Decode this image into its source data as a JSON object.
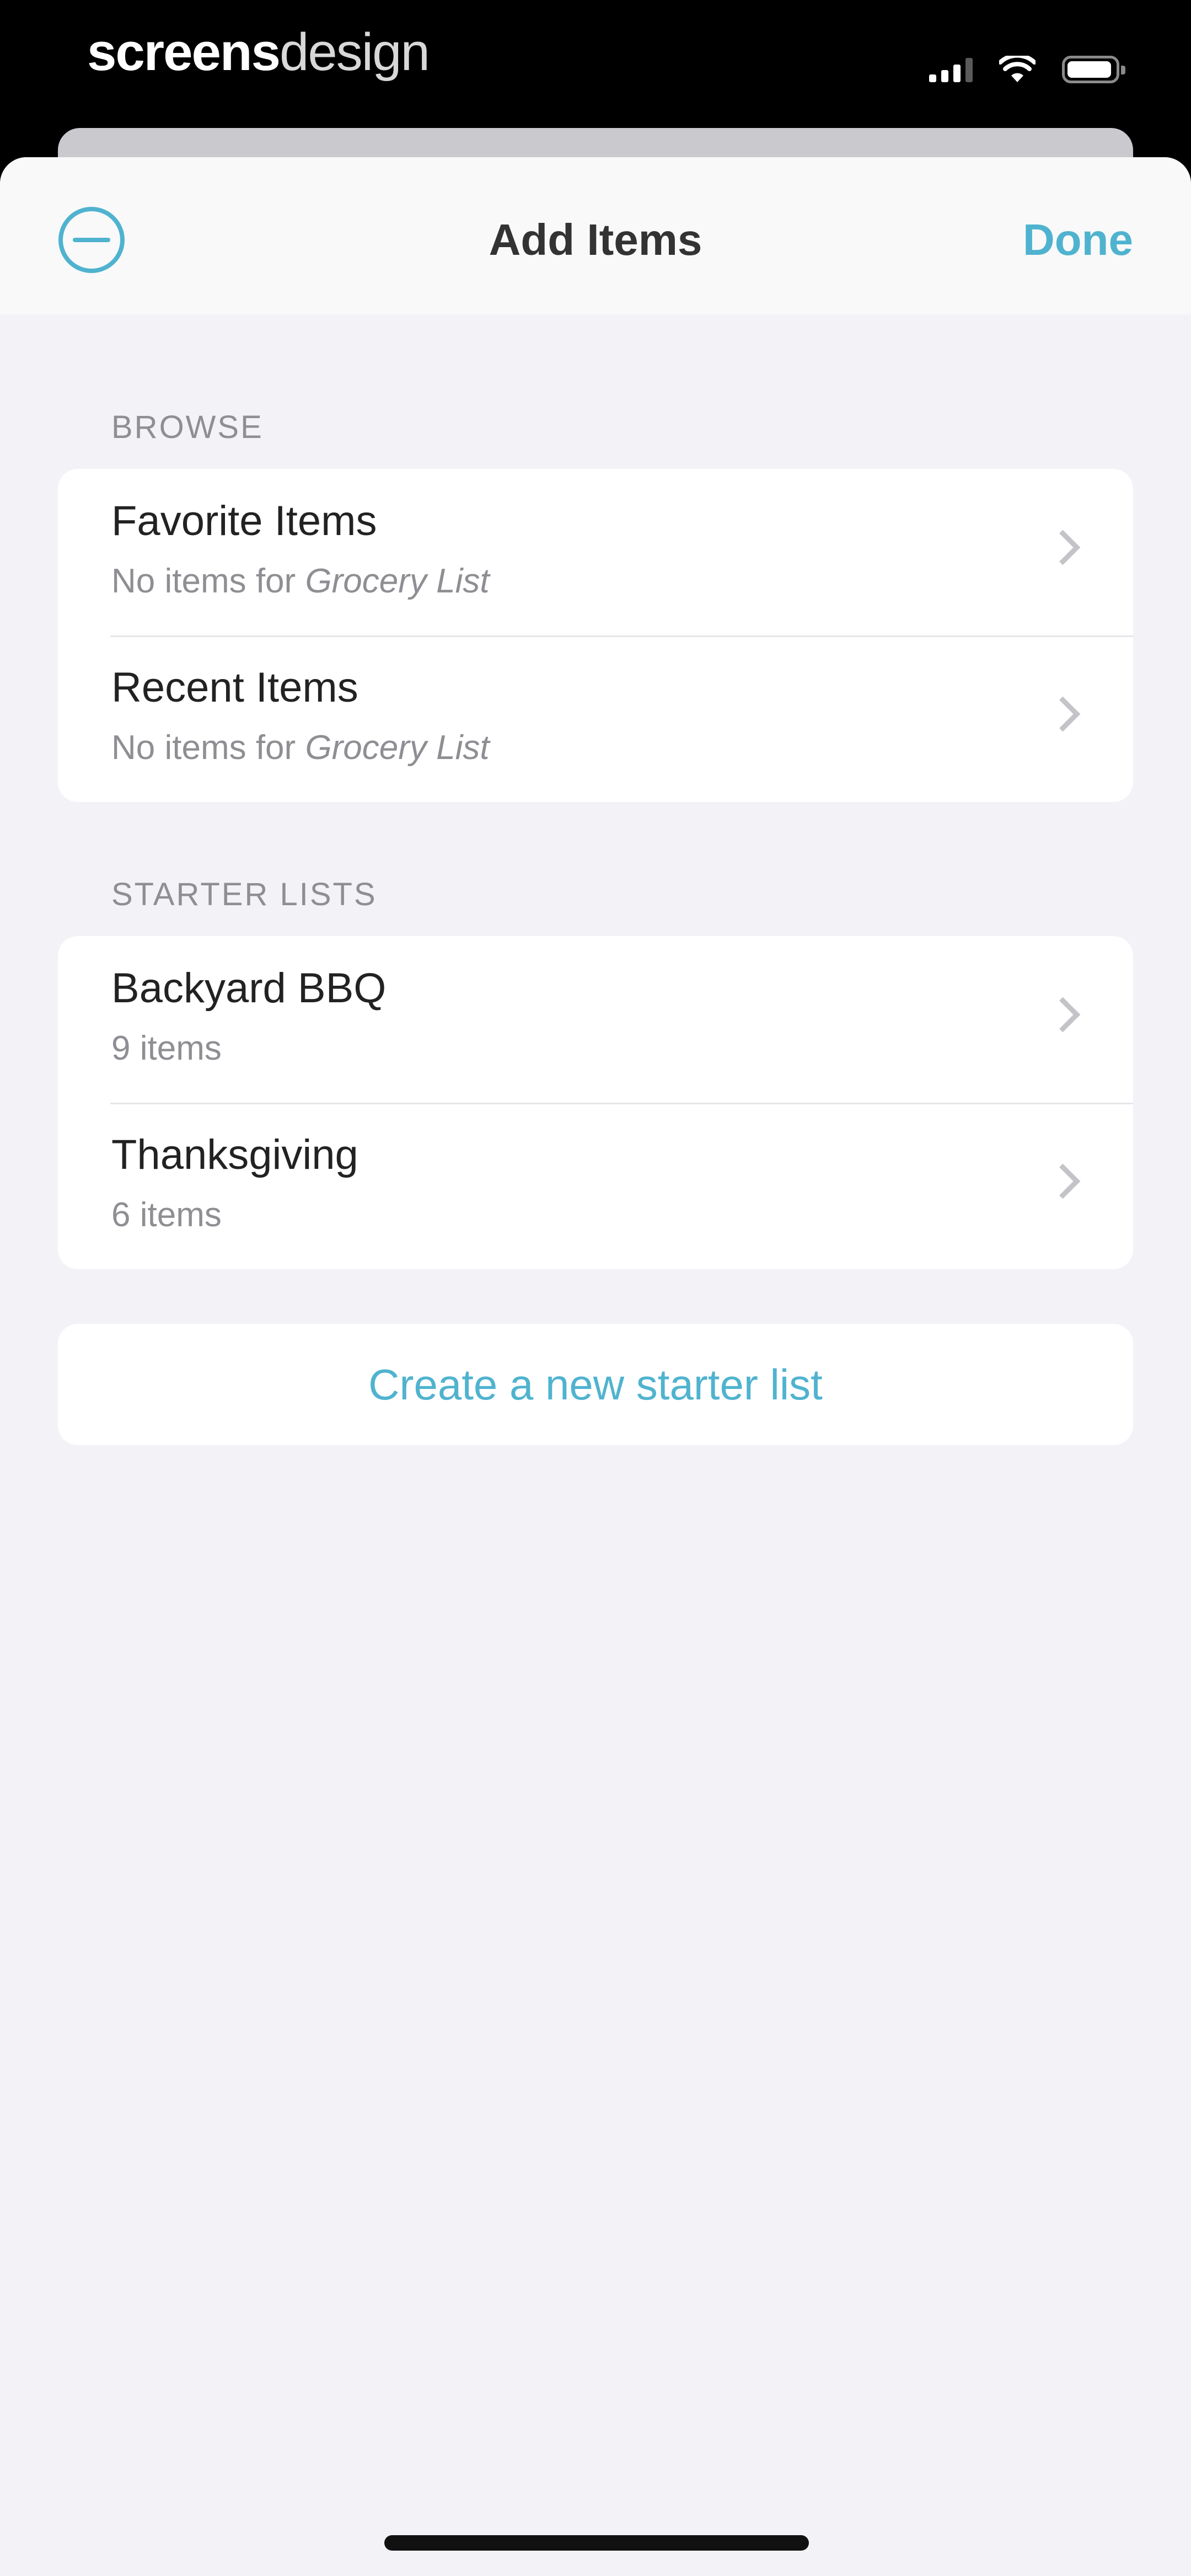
{
  "status_bar": {
    "brand_bold": "screens",
    "brand_light": "design"
  },
  "nav": {
    "title": "Add Items",
    "done_label": "Done",
    "left_icon": "minus-circle-icon"
  },
  "browse": {
    "header": "BROWSE",
    "items": [
      {
        "title": "Favorite Items",
        "subtitle_prefix": "No items for",
        "subtitle_emphasis": "Grocery List"
      },
      {
        "title": "Recent Items",
        "subtitle_prefix": "No items for",
        "subtitle_emphasis": "Grocery List"
      }
    ]
  },
  "starter_lists": {
    "header": "STARTER LISTS",
    "items": [
      {
        "title": "Backyard BBQ",
        "subtitle": "9 items"
      },
      {
        "title": "Thanksgiving",
        "subtitle": "6 items"
      }
    ]
  },
  "create_button_label": "Create a new starter list",
  "colors": {
    "accent": "#4fb3cf",
    "background": "#f2f2f7",
    "card": "#ffffff"
  }
}
